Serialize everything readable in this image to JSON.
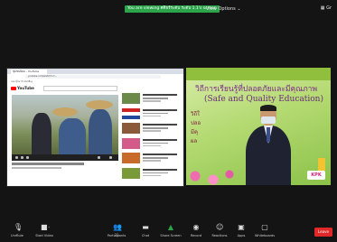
{
  "topbar": {
    "share_banner": "You are viewing ศศิธร์ระดับ ระดับ 1.1's screen",
    "view_options": "View Options ⌄",
    "grid_label": "▦ Gr"
  },
  "left_tile": {
    "browser_tab": "ชุมชนนิยม - YouTube",
    "address": "youtube.com/watch?v=...",
    "bookmarks": "แอป  บุ๊กมาร์ก  ลิงก์อื่นๆ",
    "yt_logo": "YouTube"
  },
  "right_tile": {
    "title": "วิถีการเรียนรู้ที่ปลอดภัยและมีคุณภาพ",
    "subtitle": "(Safe and Quality Education)",
    "bullets": [
      "วิถีใ",
      "ปลอ",
      "มีคุ",
      "ผล"
    ],
    "logo_text": "KPK"
  },
  "toolbar": {
    "items": [
      {
        "label": "Unmute",
        "icon": "microphone-icon"
      },
      {
        "label": "Start Video",
        "icon": "video-camera-icon"
      },
      {
        "label": "Participants",
        "icon": "participants-icon"
      },
      {
        "label": "Chat",
        "icon": "chat-icon"
      },
      {
        "label": "Share Screen",
        "icon": "share-screen-icon"
      },
      {
        "label": "Record",
        "icon": "record-icon"
      },
      {
        "label": "Reactions",
        "icon": "reactions-icon"
      },
      {
        "label": "Apps",
        "icon": "apps-icon"
      },
      {
        "label": "Whiteboards",
        "icon": "whiteboard-icon"
      }
    ],
    "participants_count": "33",
    "leave_label": "Leave"
  },
  "colors": {
    "background": "#141414",
    "share_banner": "#2ca44a",
    "leave": "#e02828",
    "share_screen_icon": "#2ca44a"
  }
}
